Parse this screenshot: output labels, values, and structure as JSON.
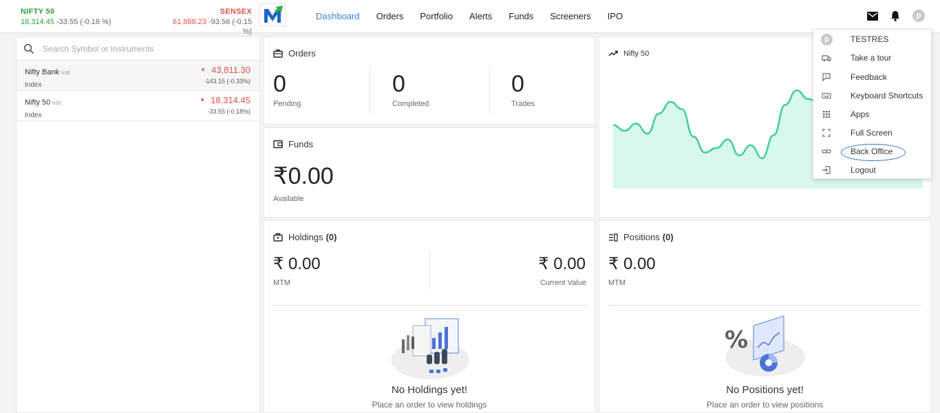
{
  "indices": {
    "nifty": {
      "name": "NIFTY 50",
      "value": "18,314.45",
      "change": "-33.55 (-0.18 %)"
    },
    "sensex": {
      "name": "SENSEX",
      "value": "61,888.23",
      "change": "-93.56 (-0.15 %)"
    }
  },
  "nav": {
    "items": [
      "Dashboard",
      "Orders",
      "Portfolio",
      "Alerts",
      "Funds",
      "Screeners",
      "IPO"
    ],
    "active": "Dashboard"
  },
  "user": {
    "initial": "p"
  },
  "search": {
    "placeholder": "Search Symbol or Instruments"
  },
  "watchlist": [
    {
      "symbol": "Nifty Bank",
      "exchange": "NSE",
      "type": "Index",
      "ltp": "43,811.30",
      "change": "-143.15 (-0.33%)"
    },
    {
      "symbol": "Nifty 50",
      "exchange": "NSE",
      "type": "Index",
      "ltp": "18,314.45",
      "change": "-33.55 (-0.18%)"
    }
  ],
  "orders": {
    "title": "Orders",
    "pending": {
      "value": "0",
      "label": "Pending"
    },
    "completed": {
      "value": "0",
      "label": "Completed"
    },
    "trades": {
      "value": "0",
      "label": "Trades"
    }
  },
  "funds": {
    "title": "Funds",
    "amount": "₹0.00",
    "label": "Available"
  },
  "chart": {
    "title": "Nifty 50",
    "line_color": "#3ecf8e",
    "fill_color": "#d8f7ee"
  },
  "chart_data": {
    "type": "area",
    "title": "Nifty 50",
    "values": [
      44,
      40,
      45,
      38,
      52,
      60,
      55,
      36,
      25,
      28,
      34,
      23,
      30,
      21,
      37,
      58,
      68,
      62,
      59,
      55,
      64,
      60,
      57,
      55,
      50,
      46,
      48,
      52
    ]
  },
  "holdings": {
    "title": "Holdings",
    "count": "(0)",
    "mtm": {
      "value": "₹ 0.00",
      "label": "MTM"
    },
    "current": {
      "value": "₹ 0.00",
      "label": "Current Value"
    },
    "empty_title": "No Holdings yet!",
    "empty_sub": "Place an order to view holdings"
  },
  "positions": {
    "title": "Positions",
    "count": "(0)",
    "mtm": {
      "value": "₹ 0.00",
      "label": "MTM"
    },
    "empty_title": "No Positions yet!",
    "empty_sub": "Place an order to view positions"
  },
  "menu": {
    "user": "TESTRES",
    "items": [
      "Take a tour",
      "Feedback",
      "Keyboard Shortcuts",
      "Apps",
      "Full Screen",
      "Back Office",
      "Logout"
    ],
    "highlighted": "Back Office"
  },
  "colors": {
    "accent": "#387ed1",
    "up": "#2e9e3f",
    "down": "#df514c"
  }
}
